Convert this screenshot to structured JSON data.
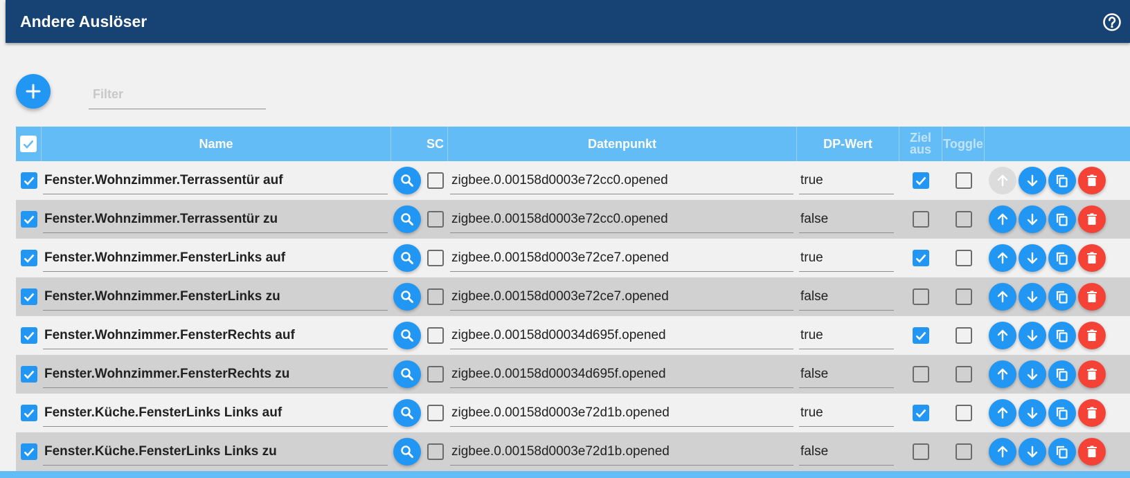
{
  "header": {
    "title": "Andere Auslöser"
  },
  "filter": {
    "placeholder": "Filter"
  },
  "columns": {
    "name": "Name",
    "sc": "SC",
    "datapoint": "Datenpunkt",
    "dp_value": "DP-Wert",
    "ziel_aus": "Ziel aus",
    "toggle": "Toggle"
  },
  "rows": [
    {
      "name": "Fenster.Wohnzimmer.Terrassentür auf",
      "datapoint": "zigbee.0.00158d0003e72cc0.opened",
      "dp_value": "true",
      "enabled": true,
      "sc": false,
      "ziel_aus": true,
      "toggle": false,
      "up_disabled": true
    },
    {
      "name": "Fenster.Wohnzimmer.Terrassentür zu",
      "datapoint": "zigbee.0.00158d0003e72cc0.opened",
      "dp_value": "false",
      "enabled": true,
      "sc": false,
      "ziel_aus": false,
      "toggle": false,
      "up_disabled": false
    },
    {
      "name": "Fenster.Wohnzimmer.FensterLinks auf",
      "datapoint": "zigbee.0.00158d0003e72ce7.opened",
      "dp_value": "true",
      "enabled": true,
      "sc": false,
      "ziel_aus": true,
      "toggle": false,
      "up_disabled": false
    },
    {
      "name": "Fenster.Wohnzimmer.FensterLinks zu",
      "datapoint": "zigbee.0.00158d0003e72ce7.opened",
      "dp_value": "false",
      "enabled": true,
      "sc": false,
      "ziel_aus": false,
      "toggle": false,
      "up_disabled": false
    },
    {
      "name": "Fenster.Wohnzimmer.FensterRechts auf",
      "datapoint": "zigbee.0.00158d00034d695f.opened",
      "dp_value": "true",
      "enabled": true,
      "sc": false,
      "ziel_aus": true,
      "toggle": false,
      "up_disabled": false
    },
    {
      "name": "Fenster.Wohnzimmer.FensterRechts zu",
      "datapoint": "zigbee.0.00158d00034d695f.opened",
      "dp_value": "false",
      "enabled": true,
      "sc": false,
      "ziel_aus": false,
      "toggle": false,
      "up_disabled": false
    },
    {
      "name": "Fenster.Küche.FensterLinks Links auf",
      "datapoint": "zigbee.0.00158d0003e72d1b.opened",
      "dp_value": "true",
      "enabled": true,
      "sc": false,
      "ziel_aus": true,
      "toggle": false,
      "up_disabled": false
    },
    {
      "name": "Fenster.Küche.FensterLinks Links zu",
      "datapoint": "zigbee.0.00158d0003e72d1b.opened",
      "dp_value": "false",
      "enabled": true,
      "sc": false,
      "ziel_aus": false,
      "toggle": false,
      "up_disabled": false
    }
  ],
  "colors": {
    "header_bg": "#174274",
    "table_header_bg": "#64bcf6",
    "accent_blue": "#2196f3",
    "delete_red": "#f44336"
  },
  "icons": {
    "help": "help-circle-icon",
    "add": "plus-icon",
    "search": "search-icon",
    "up": "arrow-up-icon",
    "down": "arrow-down-icon",
    "copy": "copy-icon",
    "delete": "trash-icon",
    "check": "check-icon"
  }
}
